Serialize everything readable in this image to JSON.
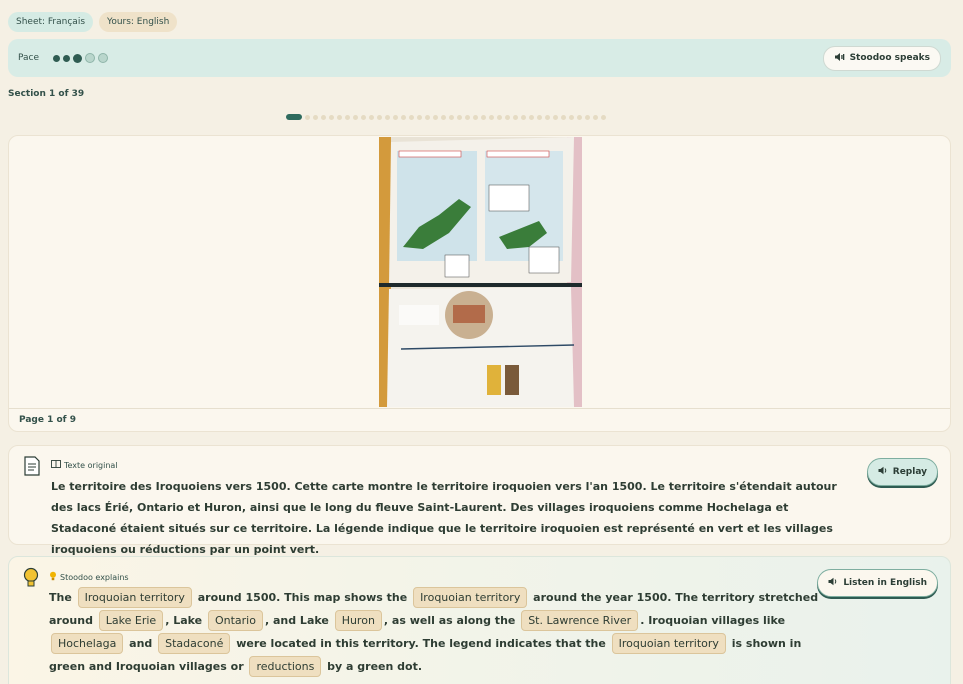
{
  "top_chips": {
    "sheet": "Sheet: Français",
    "yours": "Yours: English"
  },
  "pace": {
    "label": "Pace",
    "level": 3,
    "max": 5,
    "speaks_button": "Stoodoo speaks"
  },
  "section": {
    "label": "Section 1 of 39",
    "current": 1,
    "total": 39
  },
  "page_viewer": {
    "image_alt": "Photo of textbook page with maps of Iroquoian territory and a timeline",
    "footer": "Page 1 of 9"
  },
  "original": {
    "tag": "Texte original",
    "text": "Le territoire des Iroquoiens vers 1500. Cette carte montre le territoire iroquoien vers l'an 1500. Le territoire s'étendait autour des lacs Érié, Ontario et Huron, ainsi que le long du fleuve Saint-Laurent. Des villages iroquoiens comme Hochelaga et Stadaconé étaient situés sur ce territoire. La légende indique que le territoire iroquoien est représenté en vert et les villages iroquoiens ou réductions par un point vert.",
    "replay_button": "Replay"
  },
  "explanation": {
    "tag": "Stoodoo explains",
    "listen_button": "Listen in English",
    "segments": [
      {
        "t": "The "
      },
      {
        "t": "Iroquoian territory",
        "term": true
      },
      {
        "t": " around 1500. This map shows the "
      },
      {
        "t": "Iroquoian territory",
        "term": true
      },
      {
        "t": " around the year 1500. The territory stretched around "
      },
      {
        "t": "Lake Erie",
        "term": true
      },
      {
        "t": ", Lake "
      },
      {
        "t": "Ontario",
        "term": true
      },
      {
        "t": ", and Lake "
      },
      {
        "t": "Huron",
        "term": true
      },
      {
        "t": ", as well as along the "
      },
      {
        "t": "St. Lawrence River",
        "term": true
      },
      {
        "t": ". Iroquoian villages like "
      },
      {
        "t": "Hochelaga",
        "term": true
      },
      {
        "t": " and "
      },
      {
        "t": "Stadaconé",
        "term": true
      },
      {
        "t": " were located in this territory. The legend indicates that the "
      },
      {
        "t": "Iroquoian territory",
        "term": true
      },
      {
        "t": " is shown in green and Iroquoian villages or "
      },
      {
        "t": "reductions",
        "term": true
      },
      {
        "t": " by a green dot."
      }
    ]
  },
  "colors": {
    "accent": "#2f6b5e",
    "background": "#f5f0e4",
    "term_bg": "#efdfc0"
  },
  "icons": {
    "speaker": "speaker-icon",
    "document": "document-icon",
    "bulb": "lightbulb-icon"
  }
}
